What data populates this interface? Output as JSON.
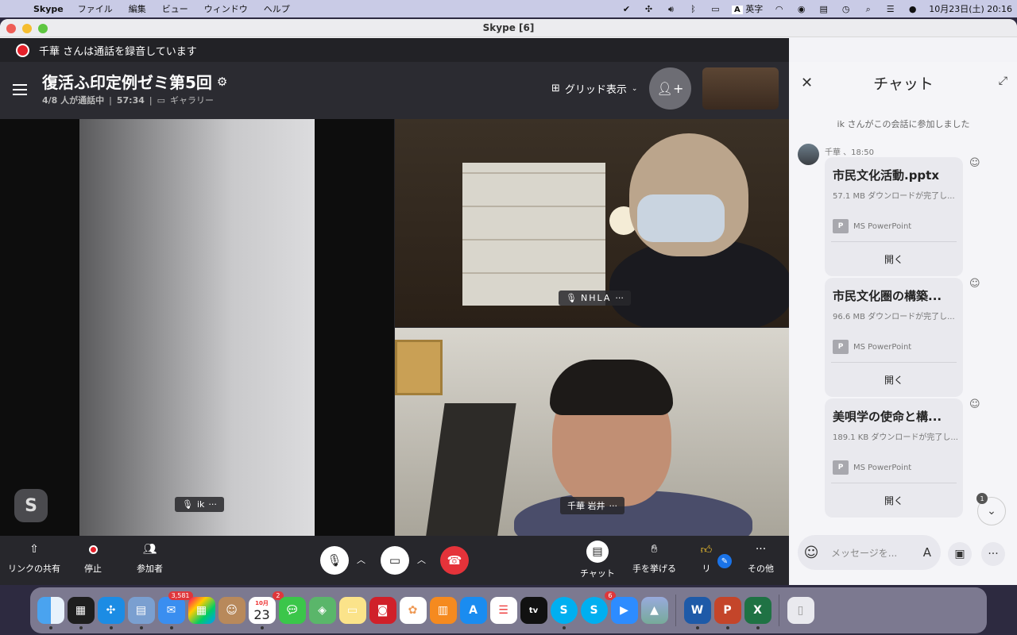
{
  "menubar": {
    "app": "Skype",
    "menus": [
      "ファイル",
      "編集",
      "ビュー",
      "ウィンドウ",
      "ヘルプ"
    ],
    "ime": "英字",
    "datetime": "10月23日(土)  20:16"
  },
  "window": {
    "title": "Skype [6]"
  },
  "recording": {
    "text": "千華 さんは通話を録音しています"
  },
  "call": {
    "title": "復活ふ印定例ゼミ第5回",
    "participants": "4/8 人が通話中",
    "duration": "57:34",
    "view": "ギャラリー",
    "grid_label": "グリッド表示"
  },
  "tiles": {
    "ik": "ik",
    "nhla": "NHLA",
    "iwai": "千華 岩井"
  },
  "controls": {
    "share": "リンクの共有",
    "stop": "停止",
    "participants": "参加者",
    "chat": "チャット",
    "raise": "手を挙げる",
    "react": "リ",
    "more": "その他"
  },
  "chat": {
    "title": "チャット",
    "system": "ik さんがこの会話に参加しました",
    "sender": "千華 、18:50",
    "files": [
      {
        "name": "市民文化活動.pptx",
        "meta": "57.1 MB ダウンロードが完了し...",
        "type": "MS PowerPoint",
        "open": "開く"
      },
      {
        "name": "市民文化圏の構築...",
        "meta": "96.6 MB ダウンロードが完了し...",
        "type": "MS PowerPoint",
        "open": "開く"
      },
      {
        "name": "美唄学の使命と構...",
        "meta": "189.1 KB ダウンロードが完了し...",
        "type": "MS PowerPoint",
        "open": "開く"
      }
    ],
    "unread": "1",
    "placeholder": "メッセージを..."
  },
  "dock": {
    "mail_badge": "3,581",
    "calendar_month": "10月",
    "calendar_day": "23",
    "calendar_badge": "2",
    "skype_badge": "6"
  }
}
